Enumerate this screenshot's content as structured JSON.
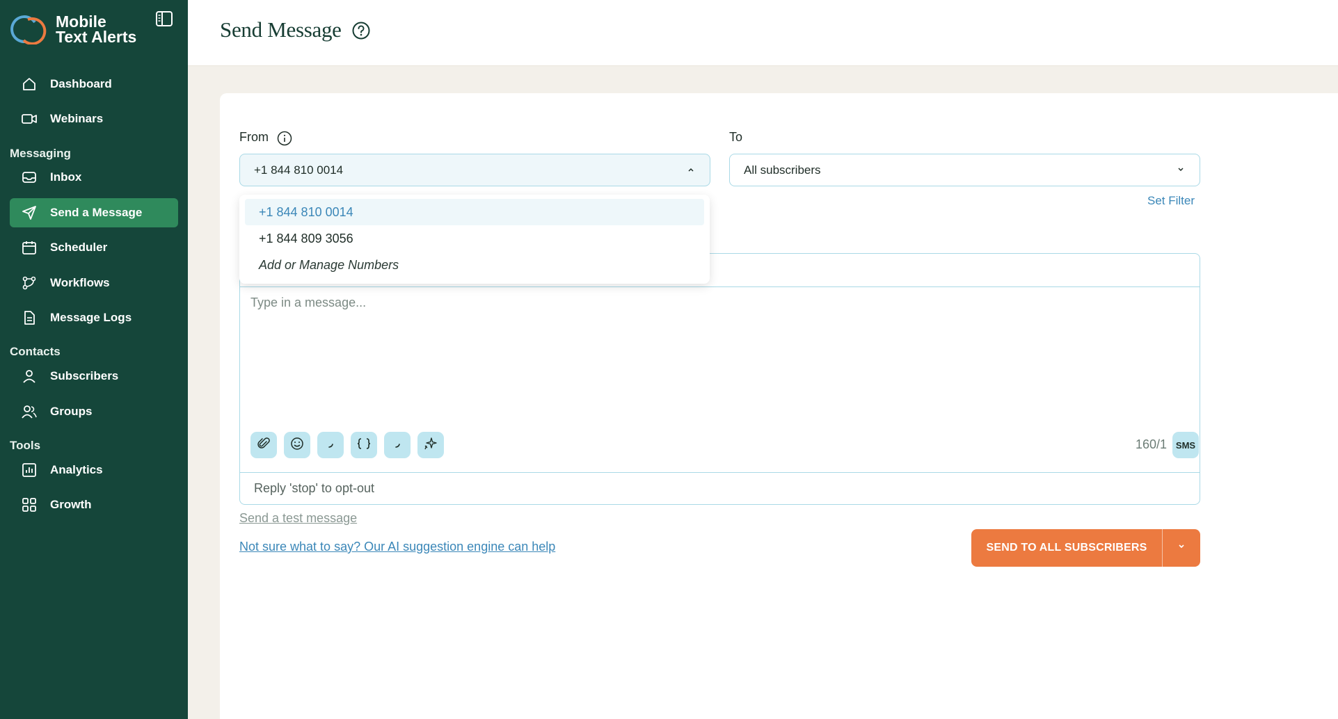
{
  "brand": {
    "line1": "Mobile",
    "line2": "Text Alerts"
  },
  "sidebar": {
    "items": [
      {
        "label": "Dashboard"
      },
      {
        "label": "Webinars"
      },
      {
        "label": "Inbox"
      },
      {
        "label": "Send a Message"
      },
      {
        "label": "Scheduler"
      },
      {
        "label": "Workflows"
      },
      {
        "label": "Message Logs"
      },
      {
        "label": "Subscribers"
      },
      {
        "label": "Groups"
      },
      {
        "label": "Analytics"
      },
      {
        "label": "Growth"
      }
    ],
    "sections": {
      "messaging": "Messaging",
      "contacts": "Contacts",
      "tools": "Tools"
    },
    "active_item": "Send a Message"
  },
  "header": {
    "title": "Send Message"
  },
  "form": {
    "from_label": "From",
    "from_value": "+1 844 810 0014",
    "to_label": "To",
    "to_value": "All subscribers",
    "set_filter": "Set Filter",
    "message_placeholder": "Type in a message...",
    "char_count": "160/1",
    "sms_badge": "SMS",
    "opt_out": "Reply 'stop' to opt-out",
    "test_link": "Send a test message",
    "ai_link": "Not sure what to say? Our AI suggestion engine can help",
    "send_label": "SEND TO ALL SUBSCRIBERS"
  },
  "dropdown": {
    "options": [
      {
        "label": "+1 844 810 0014",
        "selected": true
      },
      {
        "label": "+1 844 809 3056",
        "selected": false
      },
      {
        "label": "Add or Manage Numbers",
        "selected": false
      }
    ]
  },
  "colors": {
    "sidebar_bg": "#15463a",
    "active_item": "#2f8a5c",
    "accent_blue": "#3b87b8",
    "border_blue": "#a9d9e6",
    "tool_bg": "#bfe6f0",
    "send_orange": "#ec7a40"
  }
}
